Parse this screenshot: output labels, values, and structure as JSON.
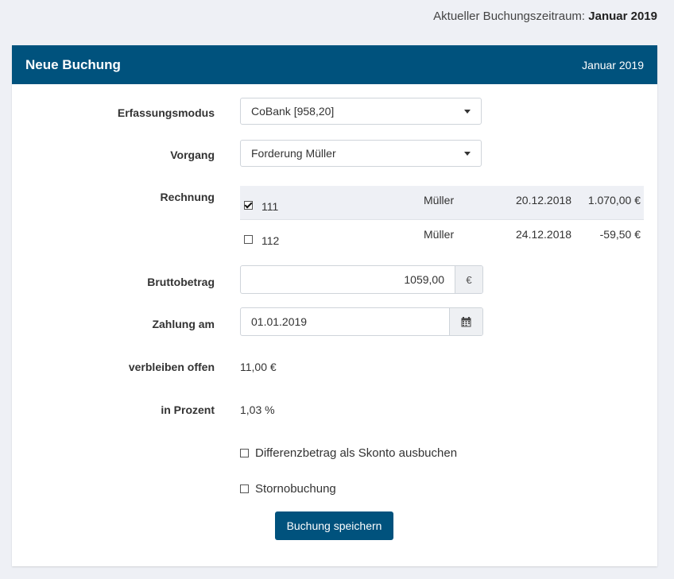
{
  "period": {
    "label": "Aktueller Buchungszeitraum:",
    "value": "Januar 2019"
  },
  "card": {
    "title": "Neue Buchung",
    "month": "Januar 2019"
  },
  "form": {
    "erfassungsmodus": {
      "label": "Erfassungsmodus",
      "value": "CoBank [958,20]"
    },
    "vorgang": {
      "label": "Vorgang",
      "value": "Forderung Müller"
    },
    "rechnung": {
      "label": "Rechnung",
      "rows": [
        {
          "checked": true,
          "number": "111",
          "name": "Müller",
          "date": "20.12.2018",
          "amount": "1.070,00 €"
        },
        {
          "checked": false,
          "number": "112",
          "name": "Müller",
          "date": "24.12.2018",
          "amount": "-59,50 €"
        }
      ]
    },
    "bruttobetrag": {
      "label": "Bruttobetrag",
      "value": "1059,00",
      "unit": "€"
    },
    "zahlung": {
      "label": "Zahlung am",
      "value": "01.01.2019"
    },
    "offen": {
      "label": "verbleiben offen",
      "value": "11,00 €"
    },
    "prozent": {
      "label": "in Prozent",
      "value": "1,03 %"
    },
    "skonto": {
      "label": "Differenzbetrag als Skonto ausbuchen",
      "checked": false
    },
    "storno": {
      "label": "Stornobuchung",
      "checked": false
    },
    "submit": "Buchung speichern"
  },
  "colors": {
    "primary": "#00527d",
    "background": "#eef0f5"
  },
  "icons": {
    "calendar": "calendar-icon",
    "caret": "chevron-down-icon"
  }
}
